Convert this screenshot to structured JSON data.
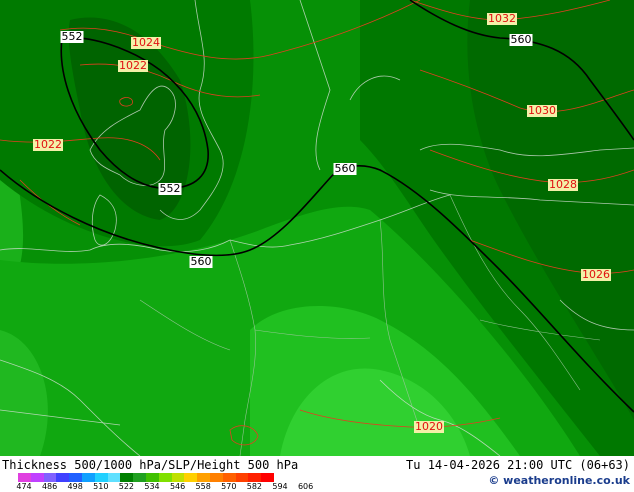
{
  "map": {
    "isolines_500_1000": [
      "552",
      "552",
      "560",
      "560",
      "560"
    ],
    "slp_isobars": [
      "1024",
      "1022",
      "1022",
      "1032",
      "1030",
      "1028",
      "1026",
      "1020"
    ]
  },
  "footer": {
    "title": "Thickness 500/1000 hPa/SLP/Height 500 hPa",
    "datetime": "Tu 14-04-2026 21:00 UTC (06+63)",
    "credit": "© weatheronline.co.uk"
  },
  "legend": {
    "ticks": [
      "474",
      "486",
      "498",
      "510",
      "522",
      "534",
      "546",
      "558",
      "570",
      "582",
      "594",
      "606"
    ],
    "colors": [
      "#e040e0",
      "#c040ff",
      "#8060ff",
      "#4040ff",
      "#2060ff",
      "#10a0ff",
      "#20d0ff",
      "#60e0ff",
      "#008000",
      "#20a020",
      "#40c000",
      "#80e000",
      "#c0e000",
      "#ffd000",
      "#ffa000",
      "#ff8000",
      "#ff6000",
      "#ff4000",
      "#ff2000",
      "#ff0000"
    ]
  }
}
